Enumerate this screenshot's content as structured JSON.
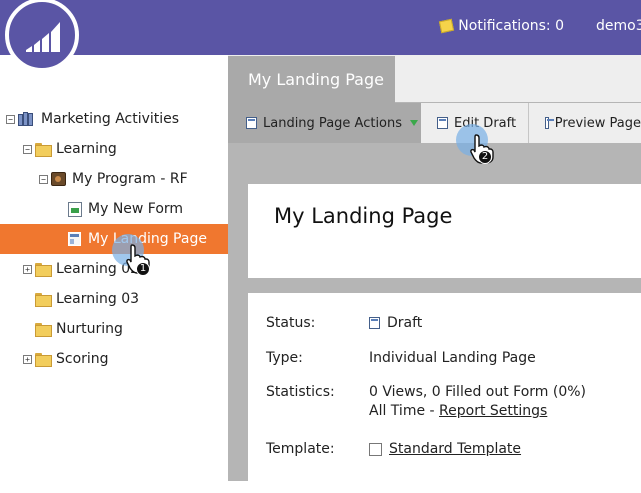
{
  "header": {
    "notifications_label": "Notifications: 0",
    "user_label": "demo3"
  },
  "tree": {
    "items": [
      {
        "label": "Marketing Activities",
        "toggle": "−"
      },
      {
        "label": "Learning",
        "toggle": "−"
      },
      {
        "label": "My Program - RF",
        "toggle": "−"
      },
      {
        "label": "My New Form",
        "toggle": ""
      },
      {
        "label": "My Landing Page",
        "toggle": ""
      },
      {
        "label": "Learning 02",
        "toggle": "+"
      },
      {
        "label": "Learning 03",
        "toggle": ""
      },
      {
        "label": "Nurturing",
        "toggle": ""
      },
      {
        "label": "Scoring",
        "toggle": "+"
      }
    ]
  },
  "tab": {
    "label": "My Landing Page"
  },
  "toolbar": {
    "actions_label": "Landing Page Actions",
    "edit_label": "Edit Draft",
    "preview_label": "Preview Page"
  },
  "page": {
    "title": "My Landing Page"
  },
  "details": {
    "status_label": "Status:",
    "status_value": "Draft",
    "type_label": "Type:",
    "type_value": "Individual Landing Page",
    "statistics_label": "Statistics:",
    "statistics_value": "0 Views, 0 Filled out Form (0%)",
    "time_prefix": "All Time -",
    "report_settings_link": "Report Settings",
    "template_label": "Template:",
    "template_value": "Standard Template"
  },
  "cursors": {
    "step1": "1",
    "step2": "2"
  }
}
